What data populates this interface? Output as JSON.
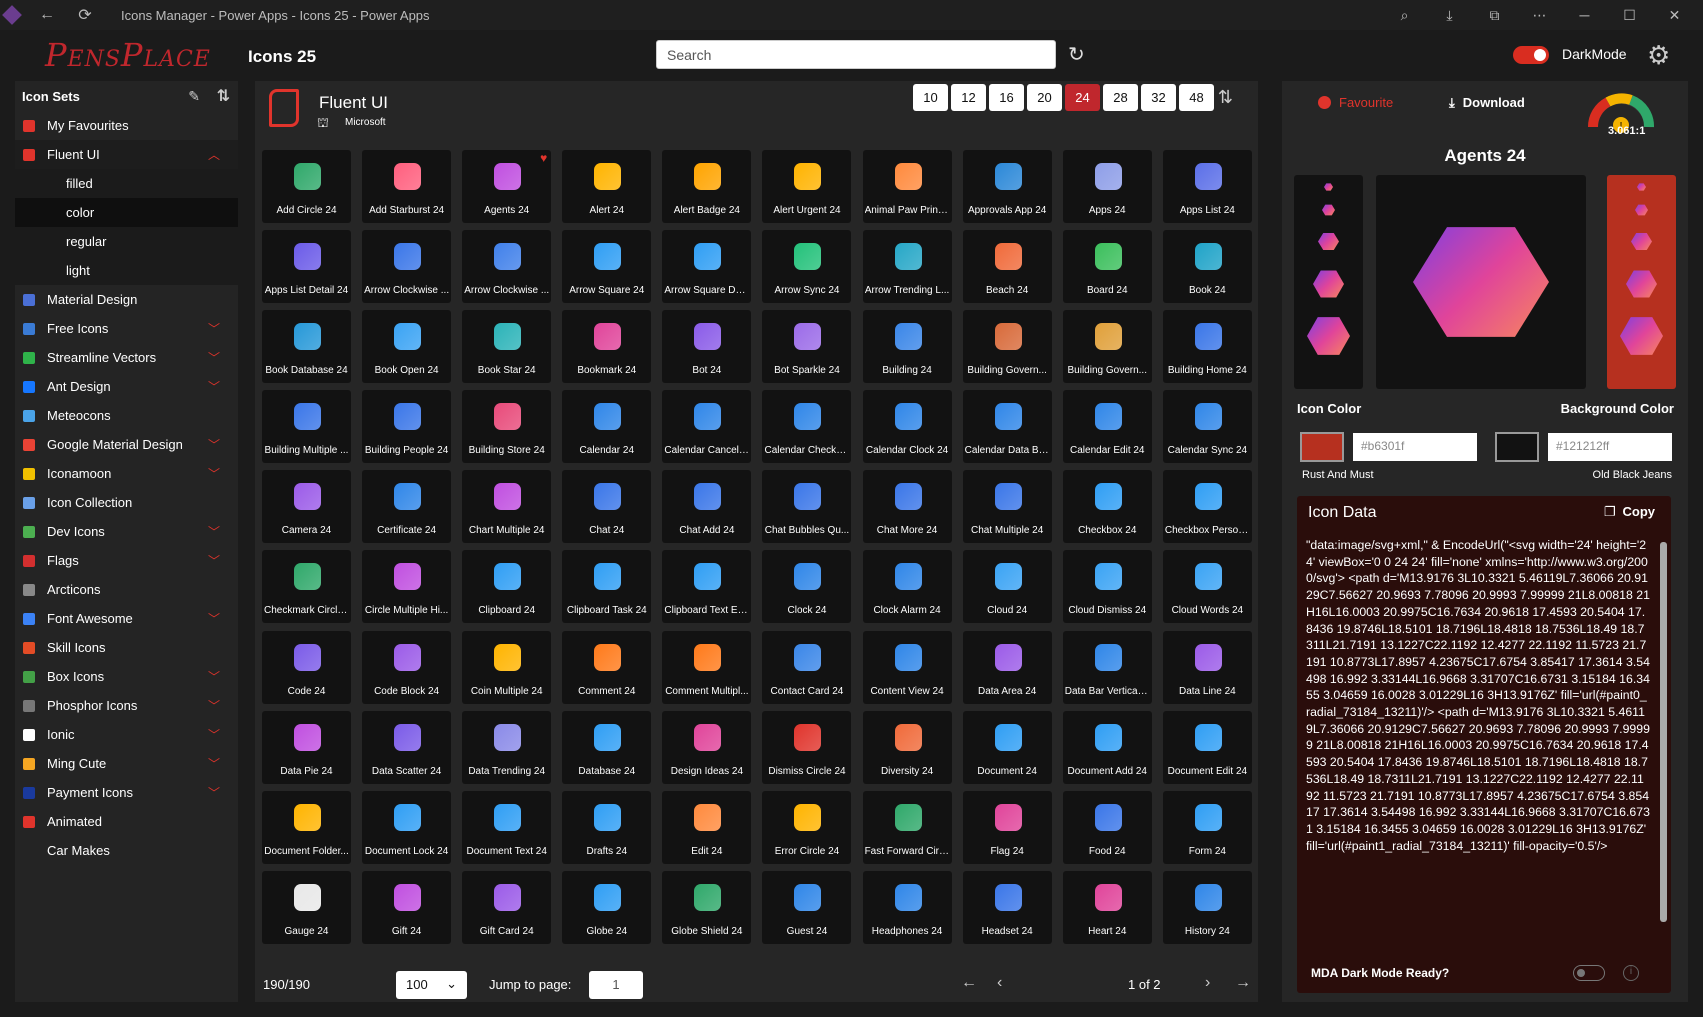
{
  "window": {
    "title": "Icons Manager - Power Apps - Icons 25 - Power Apps"
  },
  "header": {
    "logo": "PensPlace",
    "page_title": "Icons 25",
    "search_placeholder": "Search",
    "darkmode_label": "DarkMode"
  },
  "sidebar": {
    "title": "Icon Sets",
    "items": [
      {
        "label": "My Favourites",
        "color": "#e0342c",
        "chev": false
      },
      {
        "label": "Fluent UI",
        "color": "#e0342c",
        "chev": "up",
        "active": true
      },
      {
        "label": "filled",
        "sub": true
      },
      {
        "label": "color",
        "sub": true,
        "sel": true
      },
      {
        "label": "regular",
        "sub": true
      },
      {
        "label": "light",
        "sub": true
      },
      {
        "label": "Material Design",
        "color": "#4a6fd6",
        "chev": false
      },
      {
        "label": "Free Icons",
        "color": "#3a7bd5",
        "chev": true
      },
      {
        "label": "Streamline Vectors",
        "color": "#2fb34a",
        "chev": true
      },
      {
        "label": "Ant Design",
        "color": "#1677ff",
        "chev": true
      },
      {
        "label": "Meteocons",
        "color": "#4aa3e8",
        "chev": false
      },
      {
        "label": "Google Material Design",
        "color": "#ea4335",
        "chev": true
      },
      {
        "label": "Iconamoon",
        "color": "#f0c000",
        "chev": true
      },
      {
        "label": "Icon Collection",
        "color": "#6aa0e8",
        "chev": false
      },
      {
        "label": "Dev Icons",
        "color": "#4caf50",
        "chev": true
      },
      {
        "label": "Flags",
        "color": "#d32f2f",
        "chev": true
      },
      {
        "label": "Arcticons",
        "color": "#888888",
        "chev": false
      },
      {
        "label": "Font Awesome",
        "color": "#3b82f6",
        "chev": true
      },
      {
        "label": "Skill Icons",
        "color": "#e34c26",
        "chev": false
      },
      {
        "label": "Box Icons",
        "color": "#43a047",
        "chev": true
      },
      {
        "label": "Phosphor Icons",
        "color": "#777777",
        "chev": true
      },
      {
        "label": "Ionic",
        "color": "#ffffff",
        "chev": true
      },
      {
        "label": "Ming Cute",
        "color": "#f5a623",
        "chev": true
      },
      {
        "label": "Payment Icons",
        "color": "#1a3a9e",
        "chev": true
      },
      {
        "label": "Animated",
        "color": "#e0342c",
        "chev": false
      },
      {
        "label": "Car Makes",
        "color": "none",
        "chev": false
      }
    ]
  },
  "main": {
    "set_name": "Fluent UI",
    "set_author": "Microsoft",
    "sizes": [
      {
        "label": "10"
      },
      {
        "label": "12"
      },
      {
        "label": "16"
      },
      {
        "label": "20"
      },
      {
        "label": "24",
        "on": true
      },
      {
        "label": "28"
      },
      {
        "label": "32"
      },
      {
        "label": "48"
      }
    ],
    "icons": [
      {
        "label": "Add Circle 24",
        "color": "#2fa86a"
      },
      {
        "label": "Add Starburst 24",
        "color": "#ff5f7e"
      },
      {
        "label": "Agents 24",
        "color": "#c04fe0",
        "fav": true
      },
      {
        "label": "Alert 24",
        "color": "#ffb400"
      },
      {
        "label": "Alert Badge 24",
        "color": "#ffa400"
      },
      {
        "label": "Alert Urgent 24",
        "color": "#ffb300"
      },
      {
        "label": "Animal Paw Print ...",
        "color": "#ff8a3d"
      },
      {
        "label": "Approvals App 24",
        "color": "#2b88d8"
      },
      {
        "label": "Apps 24",
        "color": "#8e9ee8"
      },
      {
        "label": "Apps List 24",
        "color": "#5b6fe8"
      },
      {
        "label": "Apps List Detail 24",
        "color": "#6b5be8"
      },
      {
        "label": "Arrow Clockwise ...",
        "color": "#3a76e8"
      },
      {
        "label": "Arrow Clockwise ...",
        "color": "#4080ea"
      },
      {
        "label": "Arrow Square 24",
        "color": "#2f9ef4"
      },
      {
        "label": "Arrow Square Do...",
        "color": "#2f9ef4"
      },
      {
        "label": "Arrow Sync 24",
        "color": "#23c17a"
      },
      {
        "label": "Arrow Trending L...",
        "color": "#26a7c7"
      },
      {
        "label": "Beach 24",
        "color": "#f06a3a"
      },
      {
        "label": "Board 24",
        "color": "#3bbf5c"
      },
      {
        "label": "Book 24",
        "color": "#1fa3c8"
      },
      {
        "label": "Book Database 24",
        "color": "#2698d8"
      },
      {
        "label": "Book Open 24",
        "color": "#3aa3f4"
      },
      {
        "label": "Book Star 24",
        "color": "#2bb3b8"
      },
      {
        "label": "Bookmark 24",
        "color": "#e0449a"
      },
      {
        "label": "Bot 24",
        "color": "#8a5be8"
      },
      {
        "label": "Bot Sparkle 24",
        "color": "#9b6be8"
      },
      {
        "label": "Building 24",
        "color": "#3a86e8"
      },
      {
        "label": "Building Govern...",
        "color": "#d86a3a"
      },
      {
        "label": "Building Govern...",
        "color": "#e0a03a"
      },
      {
        "label": "Building Home 24",
        "color": "#3a76e8"
      },
      {
        "label": "Building Multiple ...",
        "color": "#3a76e8"
      },
      {
        "label": "Building People 24",
        "color": "#3a76e8"
      },
      {
        "label": "Building Store 24",
        "color": "#e84a7a"
      },
      {
        "label": "Calendar 24",
        "color": "#2f86e8"
      },
      {
        "label": "Calendar Cancel 24",
        "color": "#2f86e8"
      },
      {
        "label": "Calendar Checkm...",
        "color": "#2f86e8"
      },
      {
        "label": "Calendar Clock 24",
        "color": "#2f86e8"
      },
      {
        "label": "Calendar Data Ba...",
        "color": "#2f86e8"
      },
      {
        "label": "Calendar Edit 24",
        "color": "#2f86e8"
      },
      {
        "label": "Calendar Sync 24",
        "color": "#2f86e8"
      },
      {
        "label": "Camera 24",
        "color": "#9b5be8"
      },
      {
        "label": "Certificate 24",
        "color": "#2f86e8"
      },
      {
        "label": "Chart Multiple 24",
        "color": "#c04fe0"
      },
      {
        "label": "Chat 24",
        "color": "#3a76e8"
      },
      {
        "label": "Chat Add 24",
        "color": "#3a76e8"
      },
      {
        "label": "Chat Bubbles Qu...",
        "color": "#3a76e8"
      },
      {
        "label": "Chat More 24",
        "color": "#3a76e8"
      },
      {
        "label": "Chat Multiple 24",
        "color": "#3a76e8"
      },
      {
        "label": "Checkbox 24",
        "color": "#2f9ef4"
      },
      {
        "label": "Checkbox Person...",
        "color": "#2f9ef4"
      },
      {
        "label": "Checkmark Circle...",
        "color": "#2fa86a"
      },
      {
        "label": "Circle Multiple Hi...",
        "color": "#c04fe0"
      },
      {
        "label": "Clipboard 24",
        "color": "#2f9ef4"
      },
      {
        "label": "Clipboard Task 24",
        "color": "#2f9ef4"
      },
      {
        "label": "Clipboard Text Ed...",
        "color": "#2f9ef4"
      },
      {
        "label": "Clock 24",
        "color": "#2f86e8"
      },
      {
        "label": "Clock Alarm 24",
        "color": "#2f86e8"
      },
      {
        "label": "Cloud 24",
        "color": "#3aa3f4"
      },
      {
        "label": "Cloud Dismiss 24",
        "color": "#3aa3f4"
      },
      {
        "label": "Cloud Words 24",
        "color": "#3aa3f4"
      },
      {
        "label": "Code 24",
        "color": "#7b5be8"
      },
      {
        "label": "Code Block 24",
        "color": "#9b5be8"
      },
      {
        "label": "Coin Multiple 24",
        "color": "#ffb400"
      },
      {
        "label": "Comment 24",
        "color": "#ff7a1a"
      },
      {
        "label": "Comment Multipl...",
        "color": "#ff7a1a"
      },
      {
        "label": "Contact Card 24",
        "color": "#3a86e8"
      },
      {
        "label": "Content View 24",
        "color": "#2f86e8"
      },
      {
        "label": "Data Area 24",
        "color": "#9b5be8"
      },
      {
        "label": "Data Bar Vertical ...",
        "color": "#2f86e8"
      },
      {
        "label": "Data Line 24",
        "color": "#9b5be8"
      },
      {
        "label": "Data Pie 24",
        "color": "#c04fe0"
      },
      {
        "label": "Data Scatter 24",
        "color": "#7b5be8"
      },
      {
        "label": "Data Trending 24",
        "color": "#8a8ae8"
      },
      {
        "label": "Database 24",
        "color": "#2f9ef4"
      },
      {
        "label": "Design Ideas 24",
        "color": "#e0449a"
      },
      {
        "label": "Dismiss Circle 24",
        "color": "#e0342c"
      },
      {
        "label": "Diversity 24",
        "color": "#f06a3a"
      },
      {
        "label": "Document 24",
        "color": "#2f9ef4"
      },
      {
        "label": "Document Add 24",
        "color": "#2f9ef4"
      },
      {
        "label": "Document Edit 24",
        "color": "#2f9ef4"
      },
      {
        "label": "Document Folder...",
        "color": "#ffb400"
      },
      {
        "label": "Document Lock 24",
        "color": "#2f9ef4"
      },
      {
        "label": "Document Text 24",
        "color": "#2f9ef4"
      },
      {
        "label": "Drafts 24",
        "color": "#2f9ef4"
      },
      {
        "label": "Edit 24",
        "color": "#ff8a3d"
      },
      {
        "label": "Error Circle 24",
        "color": "#ffb400"
      },
      {
        "label": "Fast Forward Circ...",
        "color": "#2fa86a"
      },
      {
        "label": "Flag 24",
        "color": "#e0449a"
      },
      {
        "label": "Food 24",
        "color": "#3a76e8"
      },
      {
        "label": "Form 24",
        "color": "#2f9ef4"
      },
      {
        "label": "Gauge 24",
        "color": "#e8e8e8"
      },
      {
        "label": "Gift 24",
        "color": "#c04fe0"
      },
      {
        "label": "Gift Card 24",
        "color": "#9b5be8"
      },
      {
        "label": "Globe 24",
        "color": "#2f9ef4"
      },
      {
        "label": "Globe Shield 24",
        "color": "#2fa86a"
      },
      {
        "label": "Guest 24",
        "color": "#2f86e8"
      },
      {
        "label": "Headphones 24",
        "color": "#2f86e8"
      },
      {
        "label": "Headset 24",
        "color": "#3a76e8"
      },
      {
        "label": "Heart 24",
        "color": "#e0449a"
      },
      {
        "label": "History 24",
        "color": "#2f86e8"
      }
    ],
    "count": "190/190",
    "per_page": "100",
    "jump_label": "Jump to page:",
    "jump_value": "1",
    "page_text": "1 of 2"
  },
  "right": {
    "favourite": "Favourite",
    "download": "Download",
    "ratio": "3.061:1",
    "preview_title": "Agents 24",
    "icon_color_label": "Icon Color",
    "bg_color_label": "Background Color",
    "icon_color": "#b6301f",
    "icon_color_hex": "#b6301f",
    "icon_color_name": "Rust And Must",
    "bg_color": "#121212",
    "bg_color_hex": "#121212ff",
    "bg_color_name": "Old Black Jeans",
    "data_title": "Icon Data",
    "copy_label": "Copy",
    "code": "\"data:image/svg+xml,\" & EncodeUrl(\"<svg width='24' height='24' viewBox='0 0 24 24' fill='none' xmlns='http://www.w3.org/2000/svg'> <path d='M13.9176 3L10.3321 5.46119L7.36066 20.9129C7.56627 20.9693 7.78096 20.9993 7.99999 21L8.00818 21H16L16.0003 20.9975C16.7634 20.9618 17.4593 20.5404 17.8436 19.8746L18.5101 18.7196L18.4818 18.7536L18.49 18.7311L21.7191 13.1227C22.1192 12.4277 22.1192 11.5723 21.7191 10.8773L17.8957 4.23675C17.6754 3.85417 17.3614 3.54498 16.992 3.33144L16.9668 3.31707C16.6731 3.15184 16.3455 3.04659 16.0028 3.01229L16 3H13.9176Z' fill='url(#paint0_radial_73184_13211)'/> <path d='M13.9176 3L10.3321 5.46119L7.36066 20.9129C7.56627 20.9693 7.78096 20.9993 7.99999 21L8.00818 21H16L16.0003 20.9975C16.7634 20.9618 17.4593 20.5404 17.8436 19.8746L18.5101 18.7196L18.4818 18.7536L18.49 18.7311L21.7191 13.1227C22.1192 12.4277 22.1192 11.5723 21.7191 10.8773L17.8957 4.23675C17.6754 3.85417 17.3614 3.54498 16.992 3.33144L16.9668 3.31707C16.6731 3.15184 16.3455 3.04659 16.0028 3.01229L16 3H13.9176Z' fill='url(#paint1_radial_73184_13211)' fill-opacity='0.5'/>",
    "mda_label": "MDA Dark Mode Ready?"
  }
}
